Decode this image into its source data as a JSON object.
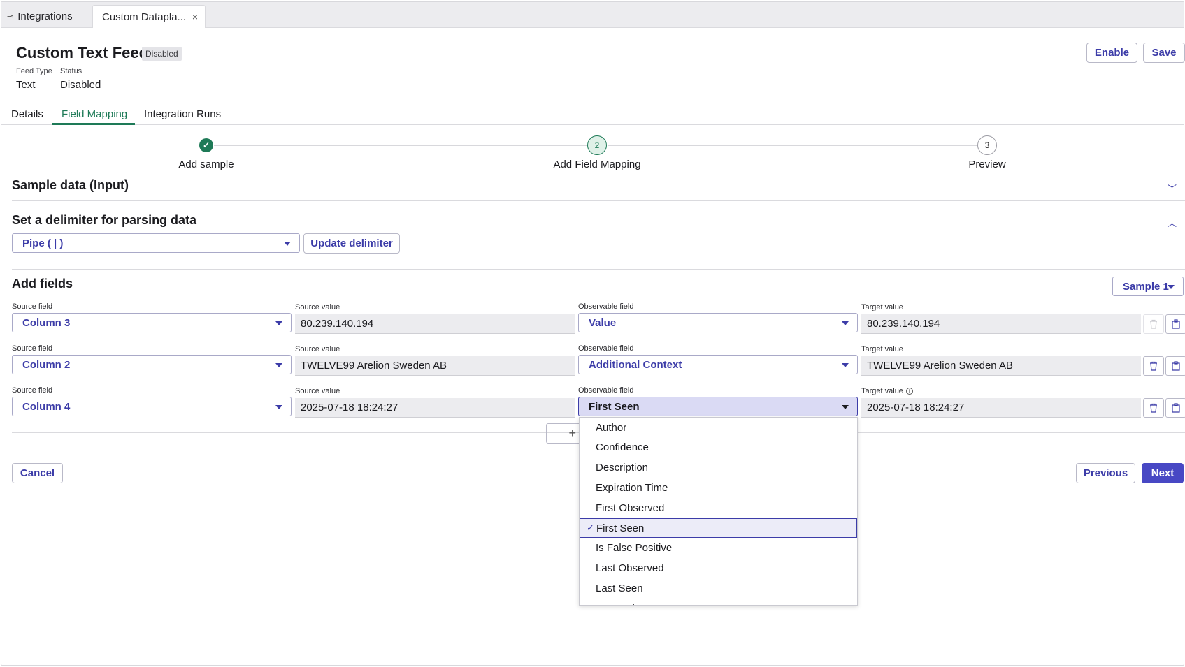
{
  "tabs": {
    "integrations_label": "Integrations",
    "active_label": "Custom Datapla...",
    "close_symbol": "×"
  },
  "header": {
    "title": "Custom Text Feed",
    "badge": "Disabled",
    "feed_type_label": "Feed Type",
    "feed_type_value": "Text",
    "status_label": "Status",
    "status_value": "Disabled",
    "enable_button": "Enable",
    "save_button": "Save"
  },
  "page_tabs": [
    "Details",
    "Field Mapping",
    "Integration Runs"
  ],
  "active_page_tab": "Field Mapping",
  "stepper": {
    "steps": [
      {
        "number": "1",
        "label": "Add sample",
        "state": "done"
      },
      {
        "number": "2",
        "label": "Add Field Mapping",
        "state": "current"
      },
      {
        "number": "3",
        "label": "Preview",
        "state": "upcoming"
      }
    ]
  },
  "sections": {
    "sample_data_title": "Sample data (Input)",
    "delimiter_title": "Set a delimiter for parsing data",
    "delimiter_value": "Pipe ( | )",
    "update_delimiter_button": "Update delimiter",
    "add_fields_title": "Add fields",
    "sample_select": "Sample 1"
  },
  "field_rows": [
    {
      "source_field_label": "Source field",
      "source_field": "Column 3",
      "source_value_label": "Source value",
      "source_value": "80.239.140.194",
      "observable_field_label": "Observable field",
      "observable_field": "Value",
      "target_value_label": "Target value",
      "target_value": "80.239.140.194"
    },
    {
      "source_field_label": "Source field",
      "source_field": "Column 2",
      "source_value_label": "Source value",
      "source_value": "TWELVE99 Arelion Sweden AB",
      "observable_field_label": "Observable field",
      "observable_field": "Additional Context",
      "target_value_label": "Target value",
      "target_value": "TWELVE99 Arelion Sweden AB"
    },
    {
      "source_field_label": "Source field",
      "source_field": "Column 4",
      "source_value_label": "Source value",
      "source_value": "2025-07-18 18:24:27",
      "observable_field_label": "Observable field",
      "observable_field": "First Seen",
      "target_value_label": "Target value",
      "target_value": "2025-07-18 18:24:27"
    }
  ],
  "dropdown": {
    "items": [
      "Author",
      "Confidence",
      "Description",
      "Expiration Time",
      "First Observed",
      "First Seen",
      "Is False Positive",
      "Last Observed",
      "Last Seen",
      "Reputation"
    ],
    "selected": "First Seen"
  },
  "footer": {
    "cancel_button": "Cancel",
    "previous_button": "Previous",
    "next_button": "Next"
  },
  "icons": {
    "integrations": "plug-icon",
    "step_done": "check-icon",
    "delete": "trash-icon",
    "copy": "clipboard-icon",
    "info": "info-icon"
  },
  "colors": {
    "accent": "#3c3ca8",
    "primary_button": "#4848c4",
    "success": "#1e7a57"
  }
}
